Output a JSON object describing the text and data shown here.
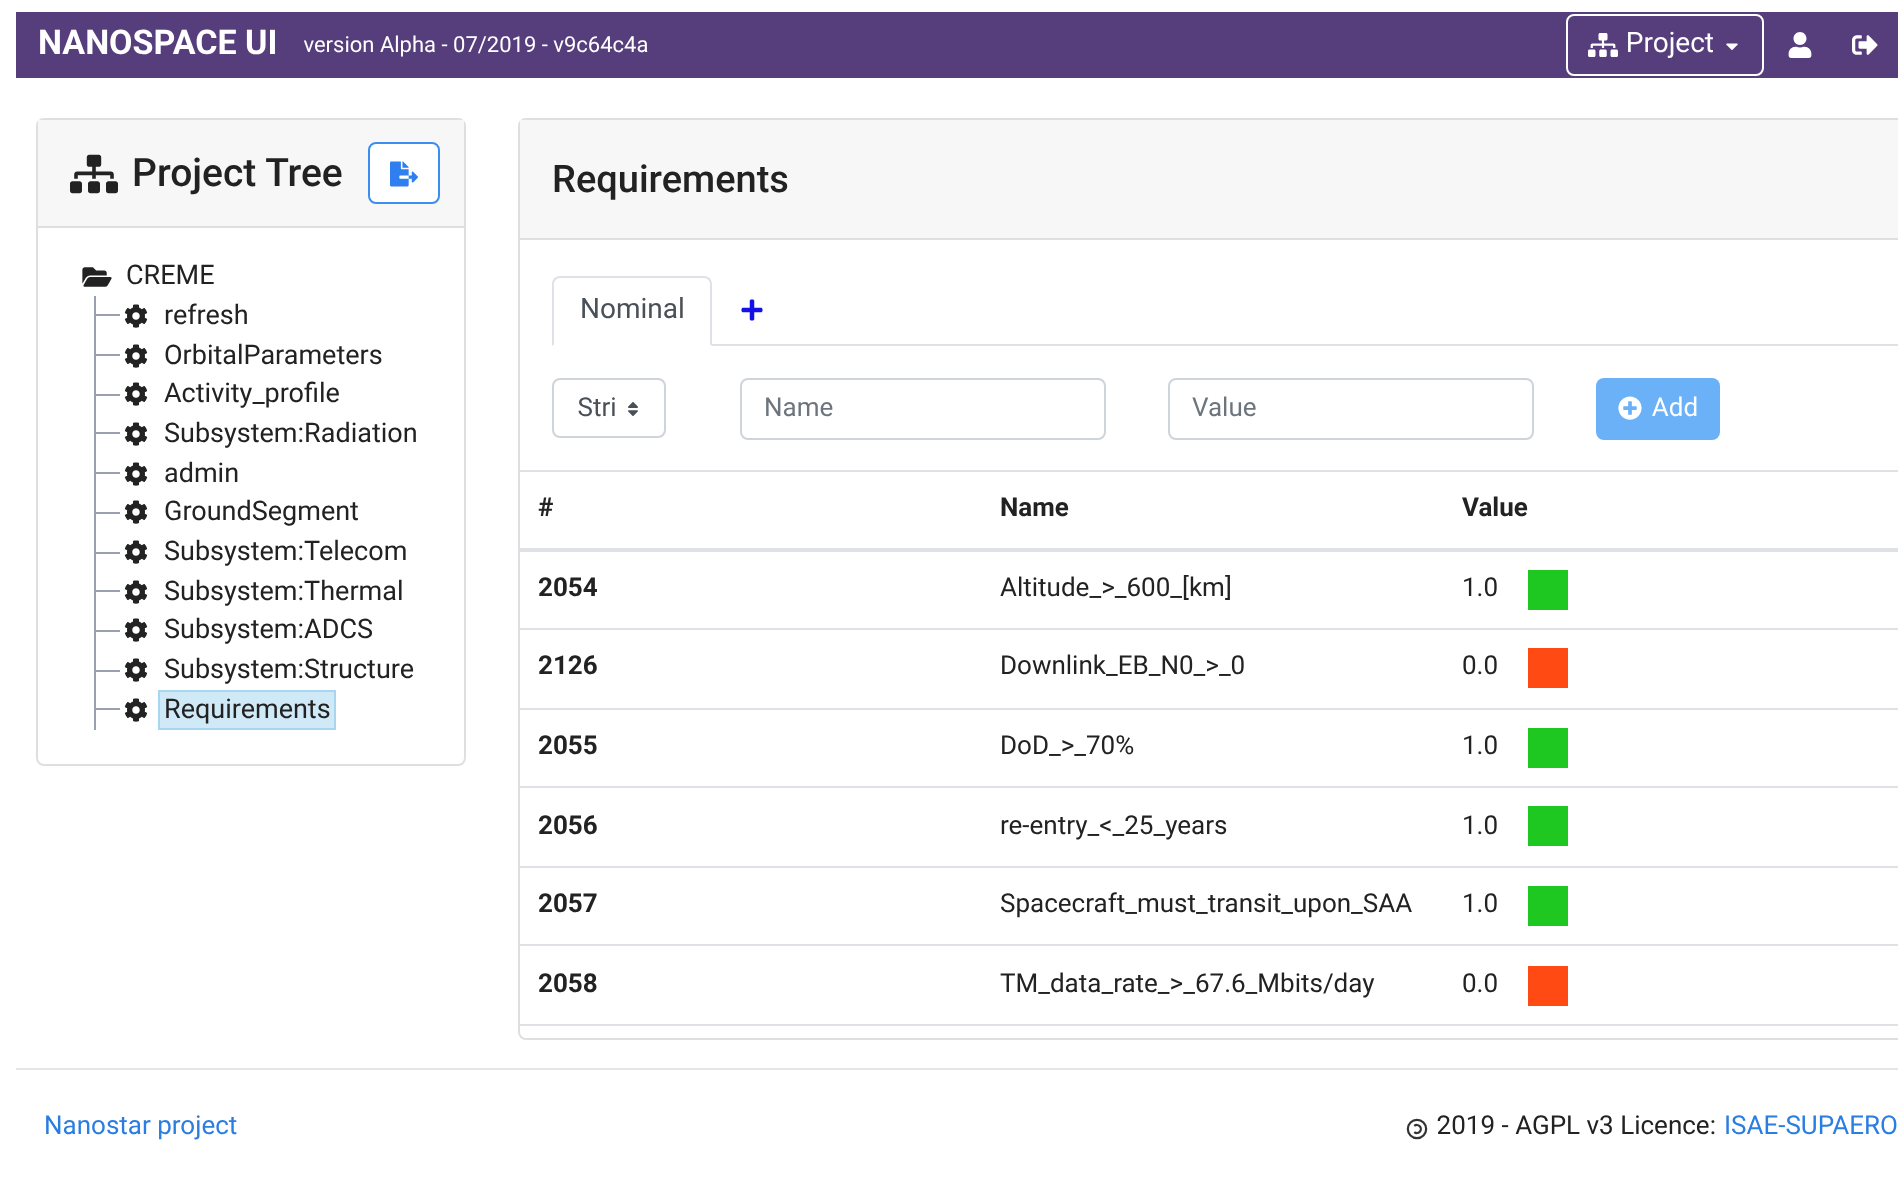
{
  "navbar": {
    "brand": "NANOSPACE UI",
    "version": "version Alpha - 07/2019 - v9c64c4a",
    "project_button": "Project"
  },
  "tree_panel": {
    "title": "Project Tree",
    "tree": [
      {
        "label": "CREME",
        "expanded": true,
        "children": [
          {
            "label": "refresh",
            "selected": false
          },
          {
            "label": "OrbitalParameters",
            "selected": false
          },
          {
            "label": "Activity_profile",
            "selected": false
          },
          {
            "label": "Subsystem:Radiation",
            "selected": false
          },
          {
            "label": "admin",
            "selected": false
          },
          {
            "label": "GroundSegment",
            "selected": false
          },
          {
            "label": "Subsystem:Telecom",
            "selected": false
          },
          {
            "label": "Subsystem:Thermal",
            "selected": false
          },
          {
            "label": "Subsystem:ADCS",
            "selected": false
          },
          {
            "label": "Subsystem:Structure",
            "selected": false
          },
          {
            "label": "Requirements",
            "selected": true
          }
        ]
      }
    ]
  },
  "main": {
    "title": "Requirements",
    "tabs": [
      {
        "label": "Nominal",
        "selected": true
      }
    ],
    "form": {
      "type_select": "Stri",
      "name_placeholder": "Name",
      "value_placeholder": "Value",
      "add_button": "Add"
    },
    "table": {
      "columns": [
        "#",
        "Name",
        "Value"
      ],
      "rows": [
        {
          "id": "2054",
          "name": "Altitude_>_600_[km]",
          "value": "1.0",
          "color": "#1fc721"
        },
        {
          "id": "2126",
          "name": "Downlink_EB_N0_>_0",
          "value": "0.0",
          "color": "#ff4a14"
        },
        {
          "id": "2055",
          "name": "DoD_>_70%",
          "value": "1.0",
          "color": "#1fc721"
        },
        {
          "id": "2056",
          "name": "re-entry_<_25_years",
          "value": "1.0",
          "color": "#1fc721"
        },
        {
          "id": "2057",
          "name": "Spacecraft_must_transit_upon_SAA",
          "value": "1.0",
          "color": "#1fc721"
        },
        {
          "id": "2058",
          "name": "TM_data_rate_>_67.6_Mbits/day",
          "value": "0.0",
          "color": "#ff4a14"
        }
      ]
    }
  },
  "footer": {
    "link": "Nanostar project",
    "licence": "2019 - AGPL v3 Licence:",
    "licence_link": "ISAE-SUPAERO"
  }
}
